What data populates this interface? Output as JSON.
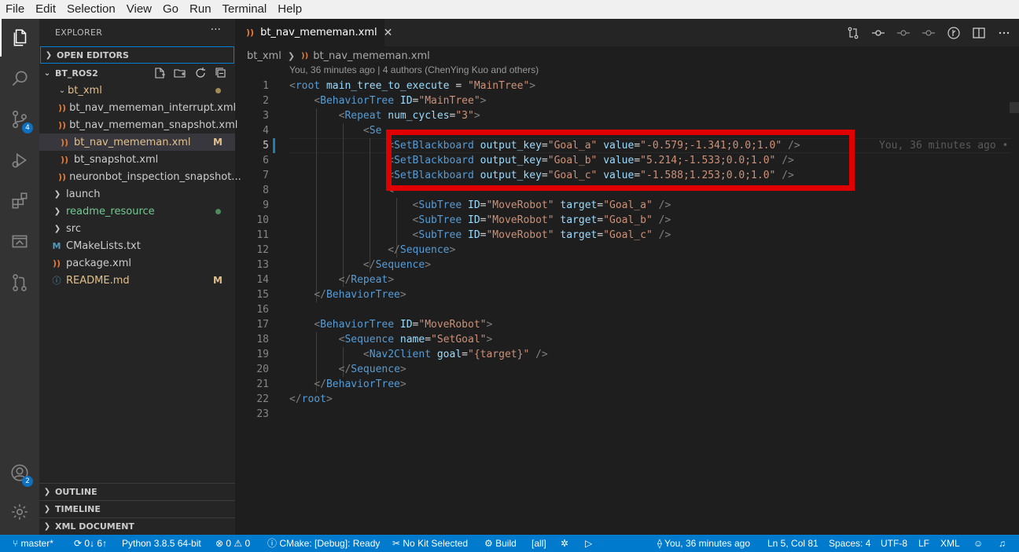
{
  "menu": [
    "File",
    "Edit",
    "Selection",
    "View",
    "Go",
    "Run",
    "Terminal",
    "Help"
  ],
  "activity": {
    "source_control_badge": "4",
    "accounts_badge": "2"
  },
  "explorer": {
    "title": "EXPLORER",
    "more": "···",
    "open_editors": "OPEN EDITORS",
    "project": "BT_ROS2",
    "tree": [
      {
        "label": "bt_xml",
        "icon": "folder",
        "git": "dot-modified"
      },
      {
        "label": "bt_nav_mememan_interrupt.xml",
        "icon": "rss-icon"
      },
      {
        "label": "bt_nav_mememan_snapshot.xml",
        "icon": "rss-icon"
      },
      {
        "label": "bt_nav_mememan.xml",
        "icon": "rss-icon",
        "git": "M"
      },
      {
        "label": "bt_snapshot.xml",
        "icon": "rss-icon"
      },
      {
        "label": "neuronbot_inspection_snapshot...",
        "icon": "rss-icon"
      },
      {
        "label": "launch",
        "icon": "folder"
      },
      {
        "label": "readme_resource",
        "icon": "folder",
        "git": "dot-untracked"
      },
      {
        "label": "src",
        "icon": "folder"
      },
      {
        "label": "CMakeLists.txt",
        "icon": "cmake-icon"
      },
      {
        "label": "package.xml",
        "icon": "rss-icon"
      },
      {
        "label": "README.md",
        "icon": "info-icon",
        "git": "M"
      }
    ],
    "outline": "OUTLINE",
    "timeline": "TIMELINE",
    "xml_document": "XML DOCUMENT"
  },
  "tab": {
    "label": "bt_nav_mememan.xml",
    "close": "✕"
  },
  "breadcrumb": {
    "folder": "bt_xml",
    "file": "bt_nav_mememan.xml"
  },
  "codelens": "You, 36 minutes ago | 4 authors (ChenYing Kuo and others)",
  "inline_blame": "You, 36 minutes ago •",
  "code_lines": [
    "<root main_tree_to_execute = \"MainTree\">",
    "    <BehaviorTree ID=\"MainTree\">",
    "        <Repeat num_cycles=\"3\">",
    "            <Se",
    "                <SetBlackboard output_key=\"Goal_a\" value=\"-0.579;-1.341;0.0;1.0\" />",
    "                <SetBlackboard output_key=\"Goal_b\" value=\"5.214;-1.533;0.0;1.0\" />",
    "                <SetBlackboard output_key=\"Goal_c\" value=\"-1.588;1.253;0.0;1.0\" />",
    "                <",
    "                    <SubTree ID=\"MoveRobot\" target=\"Goal_a\" />",
    "                    <SubTree ID=\"MoveRobot\" target=\"Goal_b\" />",
    "                    <SubTree ID=\"MoveRobot\" target=\"Goal_c\" />",
    "                </Sequence>",
    "            </Sequence>",
    "        </Repeat>",
    "    </BehaviorTree>",
    "",
    "    <BehaviorTree ID=\"MoveRobot\">",
    "        <Sequence name=\"SetGoal\">",
    "            <Nav2Client goal=\"{target}\" />",
    "        </Sequence>",
    "    </BehaviorTree>",
    "</root>",
    ""
  ],
  "current_line": 5,
  "status": {
    "branch": "master*",
    "sync": "0↓ 6↑",
    "python": "Python 3.8.5 64-bit",
    "problems": "0 ⚠ 0",
    "cmake": "CMake: [Debug]: Ready",
    "kit": "No Kit Selected",
    "build": "Build",
    "target": "[all]",
    "blame": "You, 36 minutes ago",
    "position": "Ln 5, Col 81",
    "spaces": "Spaces: 4",
    "encoding": "UTF-8",
    "eol": "LF",
    "language": "XML"
  }
}
